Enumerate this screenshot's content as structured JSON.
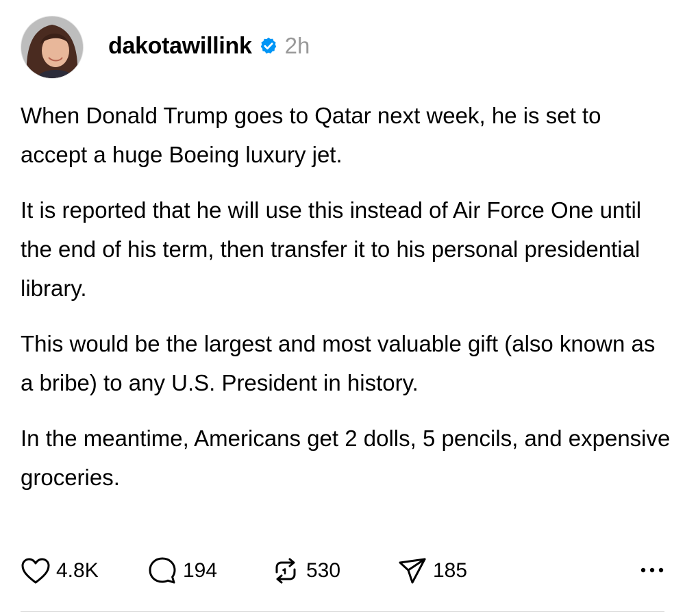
{
  "post": {
    "username": "dakotawillink",
    "timestamp": "2h",
    "paragraphs": [
      "When Donald Trump goes to Qatar next week, he is set to accept a huge Boeing luxury jet.",
      "It is reported that he will use this instead of Air Force One until the end of his term, then transfer it to his personal presidential library.",
      "This would be the largest and most valuable gift (also known as a bribe) to any U.S. President in history.",
      "In the meantime, Americans get 2 dolls, 5 pencils, and expensive groceries."
    ],
    "verified_icon": "verified-badge-icon",
    "verified_color": "#0095F6",
    "timestamp_color": "#999999"
  },
  "actions": {
    "likes": "4.8K",
    "replies": "194",
    "reposts": "530",
    "shares": "185",
    "icons": [
      "heart-icon",
      "comment-icon",
      "repost-icon",
      "share-icon",
      "more-icon"
    ]
  }
}
